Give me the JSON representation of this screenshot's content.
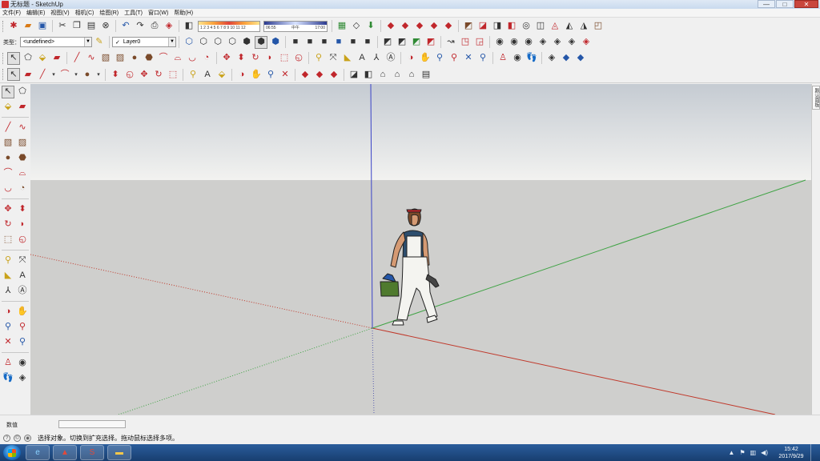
{
  "window": {
    "title": "无标题 - SketchUp",
    "buttons": {
      "minimize": "—",
      "maximize": "□",
      "close": "✕"
    }
  },
  "menu": [
    "文件(F)",
    "编辑(E)",
    "视图(V)",
    "相机(C)",
    "绘图(R)",
    "工具(T)",
    "窗口(W)",
    "帮助(H)"
  ],
  "toolbar": {
    "shadow_months": "1 2 3 4 5 6 7 8 9 10 11 12",
    "shadow_time_start": "06:55",
    "shadow_time_mid": "中午",
    "shadow_time_end": "17:00",
    "type_label": "类型：",
    "type_value": "<undefined>",
    "layer_check": "✓",
    "layer_value": "Layer0"
  },
  "right_tray": {
    "tab_label": "默认面板"
  },
  "measurements": {
    "label": "数值",
    "value": ""
  },
  "status": {
    "message": "选择对象。切换到扩充选择。拖动鼠标选择多项。"
  },
  "clock": {
    "time": "15:42",
    "date": "2017/9/29"
  },
  "colors": {
    "sky_top": "#c5cbd2",
    "sky_bottom": "#f2f2f0",
    "ground": "#cfcfcd",
    "axis_red": "#c0392b",
    "axis_green": "#3fa344",
    "axis_blue": "#3a43c7",
    "taskbar": "#1f4a82"
  }
}
